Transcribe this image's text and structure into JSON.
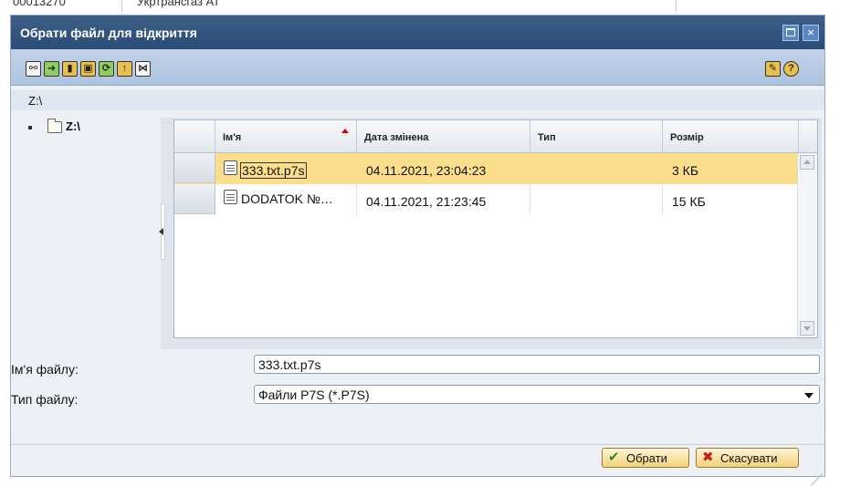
{
  "background": {
    "left_text": "00013270",
    "right_text": "Укртрансгаз АТ"
  },
  "dialog": {
    "title": "Обрати файл для відкриття",
    "window_buttons": {
      "maximize": "maximize-icon",
      "close": "×"
    }
  },
  "toolbar": {
    "left_icons": [
      "link-icon",
      "copy-to-icon",
      "delete-icon",
      "new-folder-icon",
      "refresh-icon",
      "up-folder-icon",
      "expand-icon"
    ],
    "left_glyphs": [
      "⚯",
      "➜",
      "▮",
      "▣",
      "⟳",
      "↑",
      "⋈"
    ],
    "right_icons": [
      "edit-pencil-icon",
      "help-icon"
    ],
    "right_glyphs": [
      "✎",
      "?"
    ]
  },
  "path": "Z:\\",
  "tree": {
    "root_label": "Z:\\"
  },
  "table": {
    "columns": [
      "Ім'я",
      "Дата змінена",
      "Тип",
      "Розмір"
    ],
    "rows": [
      {
        "name": "333.txt.p7s",
        "modified": "04.11.2021, 23:04:23",
        "type": "",
        "size": "3 КБ",
        "selected": true
      },
      {
        "name": "DODATOK №…",
        "modified": "04.11.2021, 21:23:45",
        "type": "",
        "size": "15 КБ",
        "selected": false
      }
    ]
  },
  "form": {
    "filename_label": "Ім'я файлу:",
    "filename_value": "333.txt.p7s",
    "filetype_label": "Тип файлу:",
    "filetype_value": "Файли P7S (*.P7S)"
  },
  "buttons": {
    "ok": {
      "icon": "✔",
      "label": "Обрати"
    },
    "cancel": {
      "icon": "✖",
      "label": "Скасувати"
    }
  },
  "colors": {
    "title_bg": "#2f5079",
    "selected_row": "#fbde8c",
    "button_bg": "#f3d27a"
  }
}
